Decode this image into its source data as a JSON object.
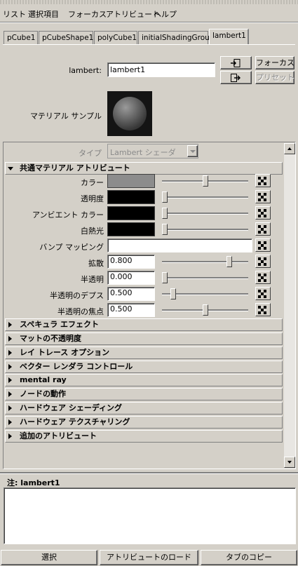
{
  "menu": [
    "リスト",
    "選択項目",
    "フォーカス",
    "アトリビュート",
    "ヘルプ"
  ],
  "tabs": [
    "pCube1",
    "pCubeShape1",
    "polyCube1",
    "initialShadingGroup",
    "lambert1"
  ],
  "active_tab": "lambert1",
  "header": {
    "type_label": "lambert:",
    "name_value": "lambert1",
    "focus_button": "フォーカス",
    "preset_button": "プリセット",
    "material_sample_label": "マテリアル サンプル"
  },
  "type_row": {
    "label": "タイプ",
    "value": "Lambert シェーダ"
  },
  "common_section": {
    "title": "共通マテリアル アトリビュート",
    "color": {
      "label": "カラー",
      "swatch": "#8c8c8c",
      "slider": 0.5
    },
    "transparency": {
      "label": "透明度",
      "swatch": "#000000",
      "slider": 0.0
    },
    "ambient": {
      "label": "アンビエント カラー",
      "swatch": "#000000",
      "slider": 0.0
    },
    "incandescence": {
      "label": "白熱光",
      "swatch": "#000000",
      "slider": 0.0
    },
    "bump": {
      "label": "バンプ マッピング"
    },
    "diffuse": {
      "label": "拡散",
      "value": "0.800",
      "slider": 0.8
    },
    "translucence": {
      "label": "半透明",
      "value": "0.000",
      "slider": 0.0
    },
    "translucence_depth": {
      "label": "半透明のデプス",
      "value": "0.500",
      "slider": 0.1
    },
    "translucence_focus": {
      "label": "半透明の焦点",
      "value": "0.500",
      "slider": 0.5
    }
  },
  "sections": [
    "スペキュラ エフェクト",
    "マットの不透明度",
    "レイ トレース オプション",
    "ベクター レンダラ コントロール",
    "mental ray",
    "ノードの動作",
    "ハードウェア シェーディング",
    "ハードウェア テクスチャリング",
    "追加のアトリビュート"
  ],
  "notes": {
    "label": "注:",
    "value": "lambert1"
  },
  "bottom_buttons": [
    "選択",
    "アトリビュートのロード",
    "タブのコピー"
  ]
}
